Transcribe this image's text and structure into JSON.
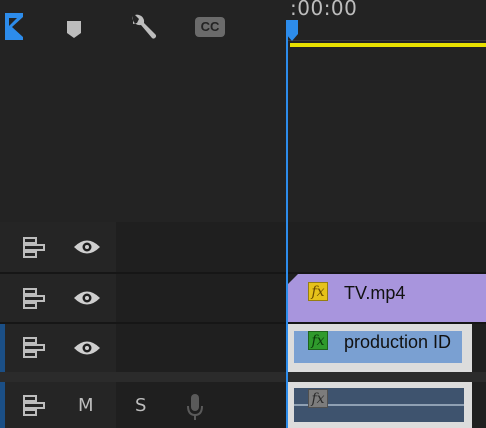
{
  "header": {
    "timecode": ":00:00",
    "tools": [
      {
        "name": "snap-tool",
        "icon": "snap-icon"
      },
      {
        "name": "add-marker",
        "icon": "marker-icon"
      },
      {
        "name": "settings",
        "icon": "wrench-icon"
      },
      {
        "name": "captions",
        "icon": "cc-icon",
        "label": "CC"
      }
    ]
  },
  "tracks": [
    {
      "kind": "video",
      "sync_icon": "sync-lock-icon",
      "visibility_icon": "eye-icon"
    },
    {
      "kind": "video",
      "sync_icon": "sync-lock-icon",
      "visibility_icon": "eye-icon"
    },
    {
      "kind": "video",
      "sync_icon": "sync-lock-icon",
      "visibility_icon": "eye-icon"
    },
    {
      "kind": "audio",
      "sync_icon": "sync-lock-icon",
      "mute_label": "M",
      "solo_label": "S",
      "voiceover_icon": "microphone-icon"
    }
  ],
  "clips": [
    {
      "name": "TV.mp4",
      "fx_label": "fx",
      "color": "#a895dd",
      "fx_color": "#e6c21a"
    },
    {
      "name": "production ID",
      "fx_label": "fx",
      "color": "#7aa0d2",
      "fx_color": "#2f9a2c"
    },
    {
      "name": "",
      "fx_label": "fx",
      "color": "#3e536e",
      "fx_color": "#7c7c7c"
    }
  ],
  "colors": {
    "playhead": "#2d8ceb",
    "work_area": "#e8e000",
    "track_accent": "#1b4f86"
  }
}
